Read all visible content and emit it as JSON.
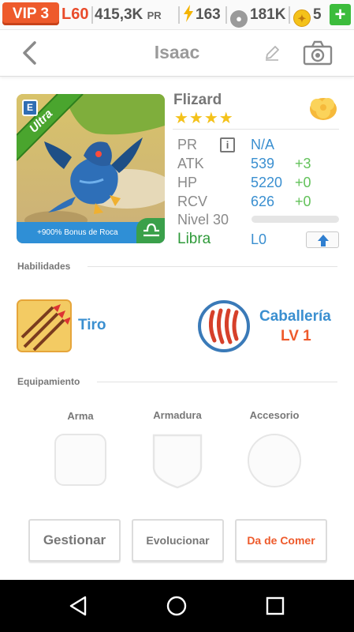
{
  "status": {
    "vip": "VIP 3",
    "level": "L60",
    "power": "415,3K",
    "power_unit": "PR",
    "energy": "163",
    "food": "181K",
    "gems": "5",
    "add": "+"
  },
  "header": {
    "title": "Isaac"
  },
  "monster": {
    "rarity": "Ultra",
    "element_badge": "E",
    "bonus": "+900% Bonus de Roca",
    "name": "Flizard",
    "stars": "★★★★",
    "stats": [
      {
        "label": "PR",
        "value": "N/A",
        "plus": ""
      },
      {
        "label": "ATK",
        "value": "539",
        "plus": "+3"
      },
      {
        "label": "HP",
        "value": "5220",
        "plus": "+0"
      },
      {
        "label": "RCV",
        "value": "626",
        "plus": "+0"
      }
    ],
    "level_label": "Nivel 30",
    "level_progress": 0.0,
    "sign_label": "Libra",
    "sign_level": "L0"
  },
  "skills": {
    "section": "Habilidades",
    "skill1": {
      "name": "Tiro"
    },
    "skill2": {
      "name": "Caballería",
      "level": "LV 1"
    }
  },
  "equipment": {
    "section": "Equipamiento",
    "weapon": "Arma",
    "armor": "Armadura",
    "accessory": "Accesorio"
  },
  "actions": {
    "manage": "Gestionar",
    "evolve": "Evolucionar",
    "feed": "Da de Comer"
  },
  "colors": {
    "accent_orange": "#ee5a2b",
    "accent_blue": "#3a8fd0",
    "positive_green": "#62c25a",
    "star_yellow": "#f4c21a"
  }
}
